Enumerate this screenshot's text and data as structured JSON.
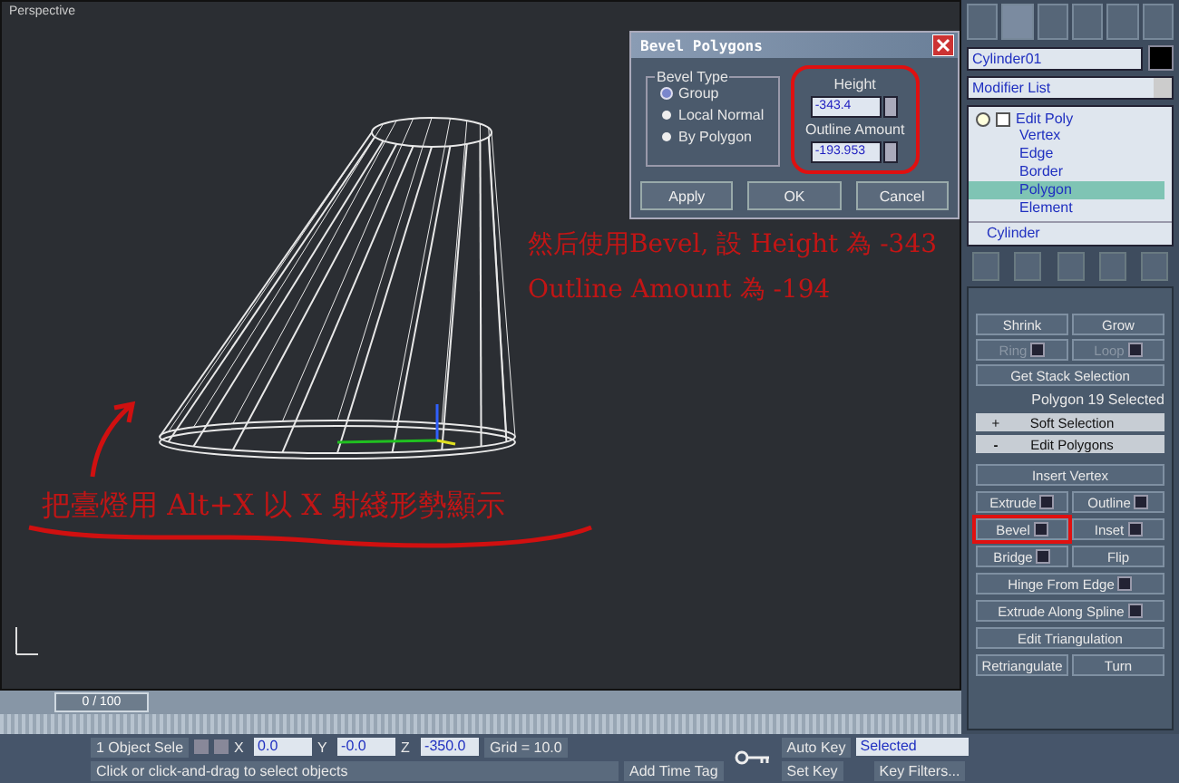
{
  "viewport": {
    "label": "Perspective",
    "annotations": [
      {
        "text": "然后使用Bevel, 設 Height 為 -343"
      },
      {
        "text": "Outline Amount 為 -194"
      },
      {
        "text": "把臺燈用 Alt+X 以 X 射綫形勢顯示"
      }
    ]
  },
  "dialog": {
    "title": "Bevel Polygons",
    "group_title": "Bevel Type",
    "options": [
      {
        "label": "Group",
        "selected": true
      },
      {
        "label": "Local Normal",
        "selected": false
      },
      {
        "label": "By Polygon",
        "selected": false
      }
    ],
    "fields": [
      {
        "label": "Height",
        "value": "-343.4"
      },
      {
        "label": "Outline Amount",
        "value": "-193.953"
      }
    ],
    "fields_highlighted": true,
    "buttons": [
      "Apply",
      "OK",
      "Cancel"
    ]
  },
  "command_panel": {
    "object_name": "Cylinder01",
    "modifier_list": "Modifier List",
    "modifier": "Edit Poly",
    "base_object": "Cylinder",
    "sub_objects": [
      {
        "label": "Vertex",
        "selected": false
      },
      {
        "label": "Edge",
        "selected": false
      },
      {
        "label": "Border",
        "selected": false
      },
      {
        "label": "Polygon",
        "selected": true
      },
      {
        "label": "Element",
        "selected": false
      }
    ],
    "selection_buttons": [
      {
        "label": "Shrink",
        "disabled": false,
        "spinner": false
      },
      {
        "label": "Grow",
        "disabled": false,
        "spinner": false
      },
      {
        "label": "Ring",
        "disabled": true,
        "spinner": true
      },
      {
        "label": "Loop",
        "disabled": true,
        "spinner": true
      }
    ],
    "stack_button": "Get Stack Selection",
    "selection_info": "Polygon 19 Selected",
    "rollouts": [
      {
        "sign": "+",
        "label": "Soft Selection",
        "expanded": false
      },
      {
        "sign": "-",
        "label": "Edit Polygons",
        "expanded": true
      }
    ],
    "buttons": [
      {
        "label": "Insert Vertex",
        "kind": "wide",
        "settings": false,
        "highlighted": false
      },
      {
        "label": "Extrude",
        "kind": "half",
        "settings": true,
        "highlighted": false
      },
      {
        "label": "Outline",
        "kind": "half",
        "settings": true,
        "highlighted": false
      },
      {
        "label": "Bevel",
        "kind": "half",
        "settings": true,
        "highlighted": true
      },
      {
        "label": "Inset",
        "kind": "half",
        "settings": true,
        "highlighted": false
      },
      {
        "label": "Bridge",
        "kind": "half",
        "settings": true,
        "highlighted": false
      },
      {
        "label": "Flip",
        "kind": "half",
        "settings": false,
        "highlighted": false
      },
      {
        "label": "Hinge From Edge",
        "kind": "wide",
        "settings": true,
        "highlighted": false
      },
      {
        "label": "Extrude Along Spline",
        "kind": "wide",
        "settings": true,
        "highlighted": false
      },
      {
        "label": "Edit Triangulation",
        "kind": "wide",
        "settings": false,
        "highlighted": false
      },
      {
        "label": "Retriangulate",
        "kind": "half",
        "settings": false,
        "highlighted": false
      },
      {
        "label": "Turn",
        "kind": "half",
        "settings": false,
        "highlighted": false
      }
    ]
  },
  "time_slider": {
    "label": "0 / 100"
  },
  "status_bar": {
    "selection": "1 Object Sele",
    "coords": [
      {
        "axis": "X",
        "value": "0.0"
      },
      {
        "axis": "Y",
        "value": "-0.0"
      },
      {
        "axis": "Z",
        "value": "-350.0"
      }
    ],
    "grid": "Grid = 10.0",
    "prompt": "Click or click-and-drag to select objects",
    "time_tag": "Add Time Tag",
    "auto_key": "Auto Key",
    "key_mode": "Selected",
    "set_key": "Set Key",
    "key_filters": "Key Filters..."
  }
}
